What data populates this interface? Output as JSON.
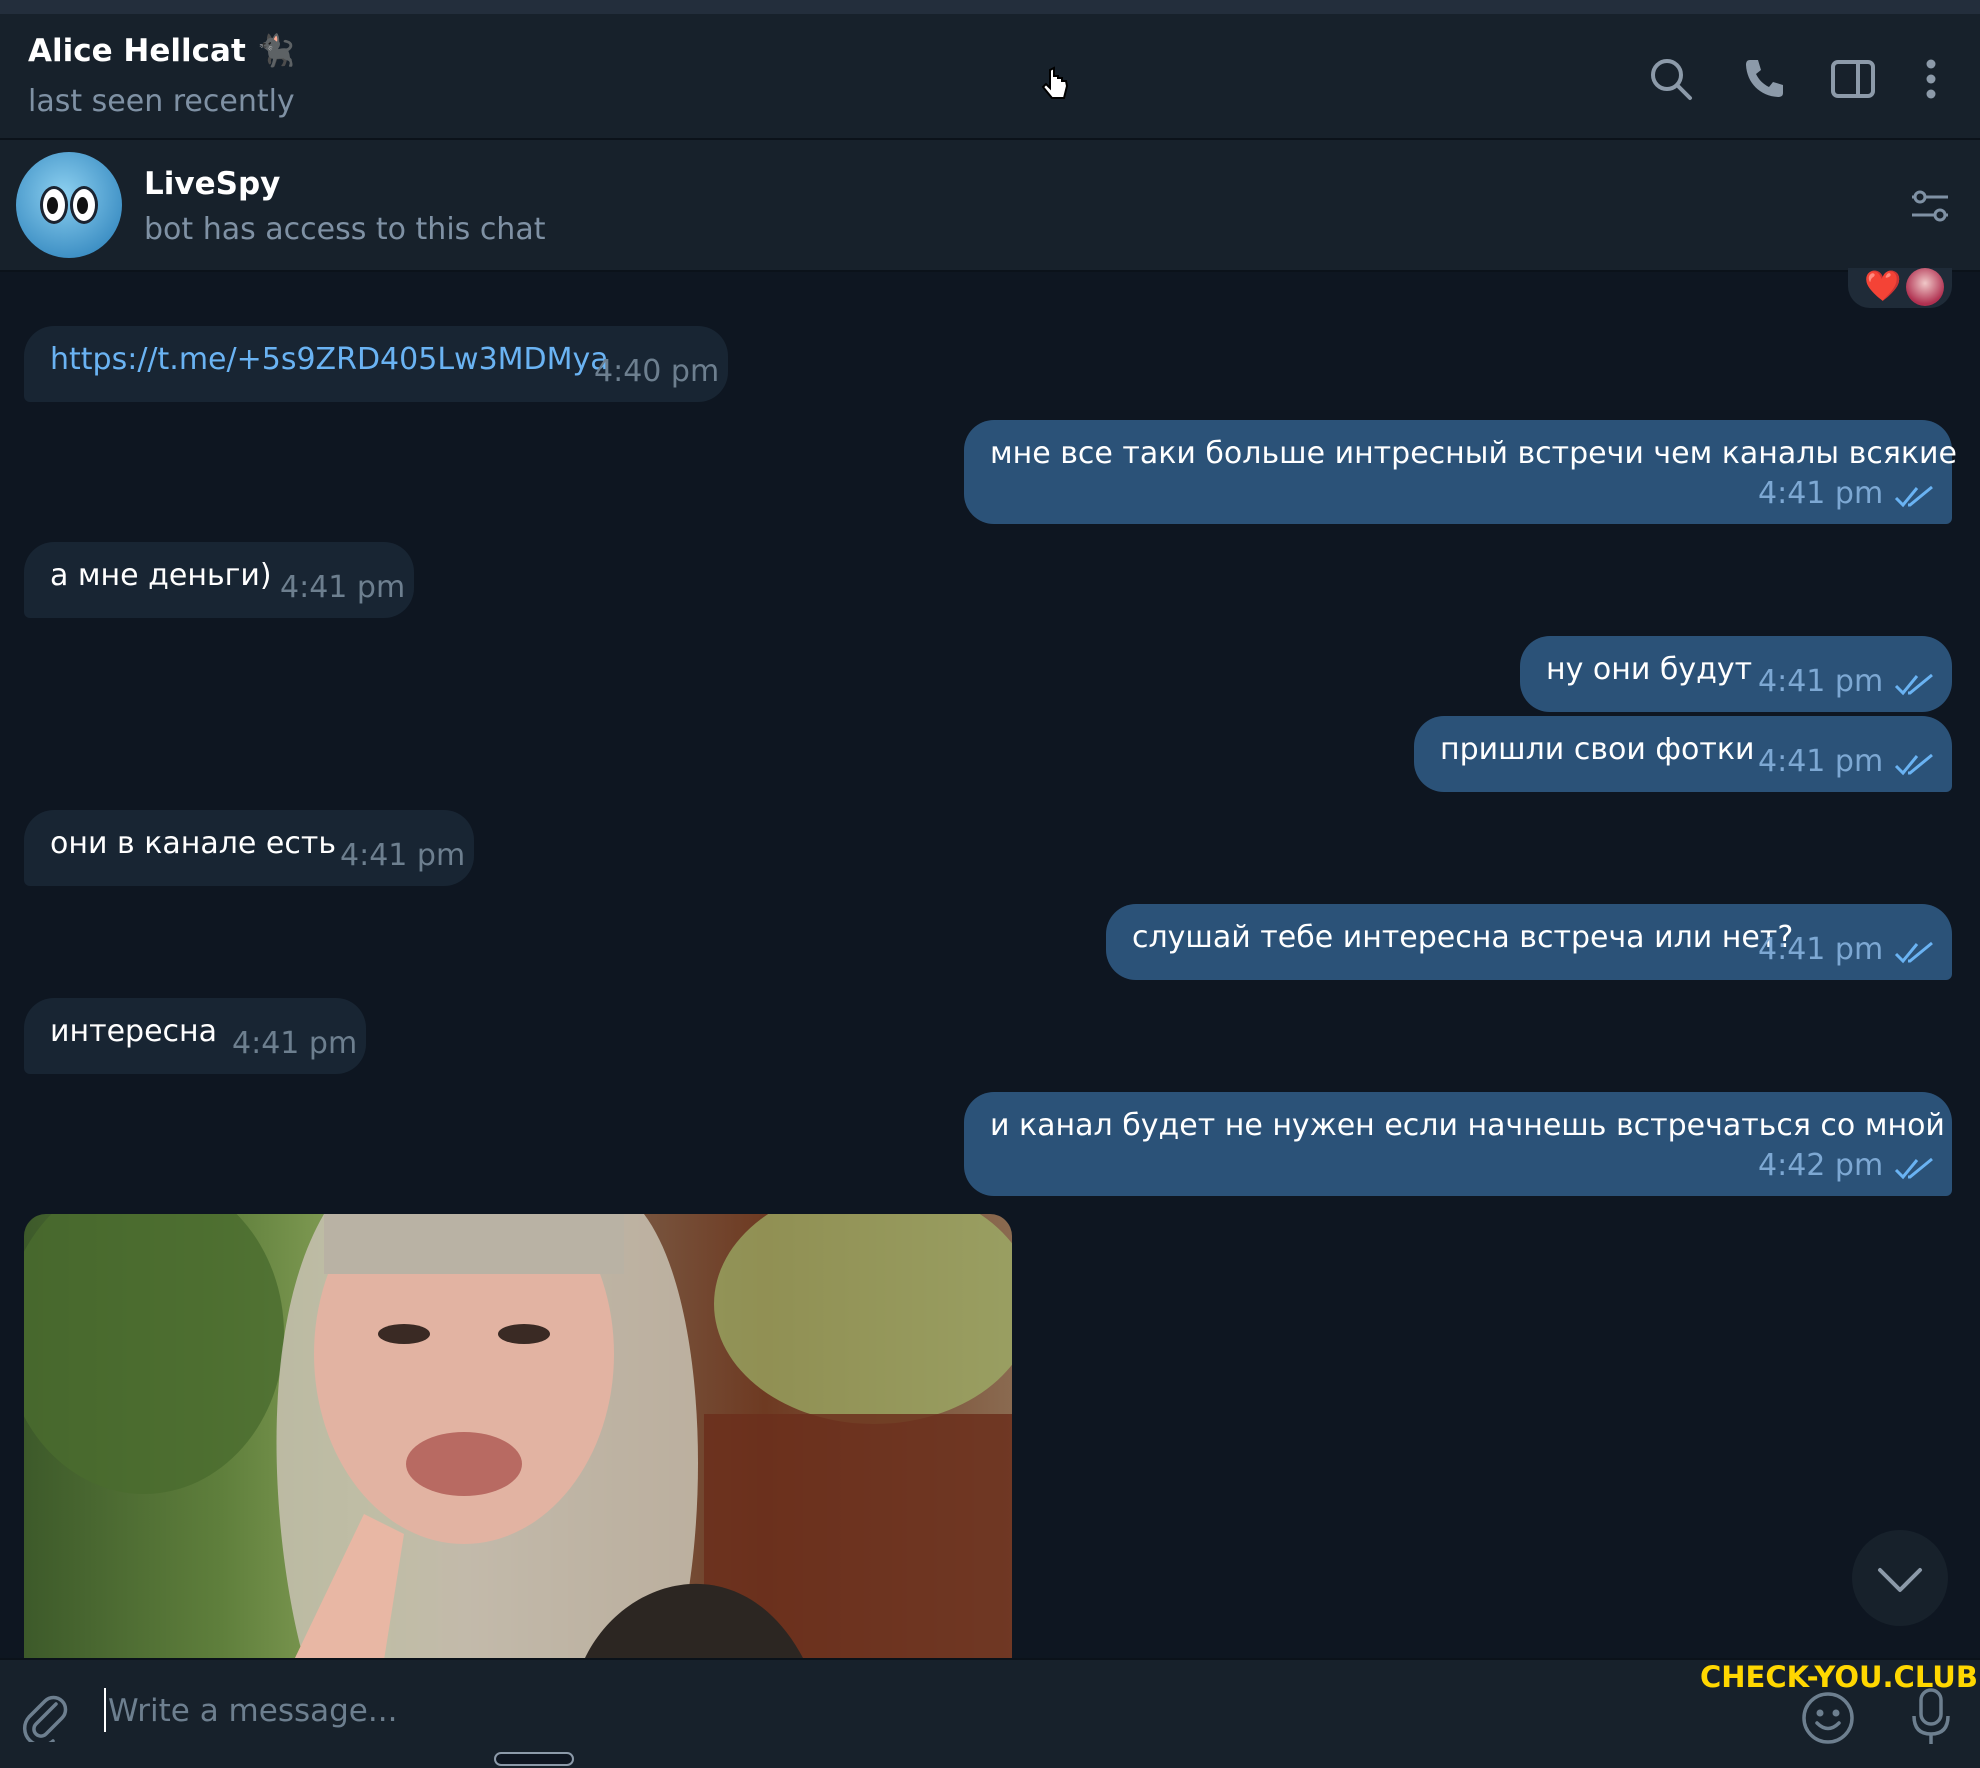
{
  "header": {
    "title": "Alice Hellcat 🐈‍⬛",
    "subtitle": "last seen recently"
  },
  "bot": {
    "name": "LiveSpy",
    "description": "bot has access to this chat"
  },
  "reaction": {
    "emoji": "❤️"
  },
  "messages": [
    {
      "direction": "in",
      "text": "https://t.me/+5s9ZRD405Lw3MDMya",
      "time": "4:40 pm",
      "is_link": true
    },
    {
      "direction": "out",
      "text": "мне все таки больше интресный встречи чем каналы всякие",
      "time": "4:41 pm",
      "read": true
    },
    {
      "direction": "in",
      "text": "а мне деньги)",
      "time": "4:41 pm"
    },
    {
      "direction": "out",
      "text": "ну они будут",
      "time": "4:41 pm",
      "read": true
    },
    {
      "direction": "out",
      "text": "пришли свои фотки",
      "time": "4:41 pm",
      "read": true
    },
    {
      "direction": "in",
      "text": "они в канале есть",
      "time": "4:41 pm"
    },
    {
      "direction": "out",
      "text": "слушай тебе интересна встреча или нет?",
      "time": "4:41 pm",
      "read": true
    },
    {
      "direction": "in",
      "text": "интересна",
      "time": "4:41 pm"
    },
    {
      "direction": "out",
      "text": "и канал будет не нужен если начнешь встречаться со мной",
      "time": "4:42 pm",
      "read": true
    }
  ],
  "photo": {
    "direction": "in",
    "kind": "photo"
  },
  "composer": {
    "placeholder": "Write a message...",
    "watermark": "CHECK-YOU.CLUB"
  },
  "icons": {
    "header": [
      "search-icon",
      "phone-icon",
      "sidebar-toggle-icon",
      "more-vertical-icon"
    ],
    "bot": [
      "bot-settings-icon"
    ],
    "composer": [
      "attach-icon",
      "emoji-icon",
      "microphone-icon"
    ],
    "chat": [
      "chevron-down-icon",
      "double-check-icon"
    ]
  },
  "colors": {
    "background": "#0e1621",
    "panel": "#17212b",
    "incoming_bubble": "#182533",
    "outgoing_bubble": "#2b5278",
    "link": "#6ab3f3",
    "watermark": "#ffd700"
  }
}
